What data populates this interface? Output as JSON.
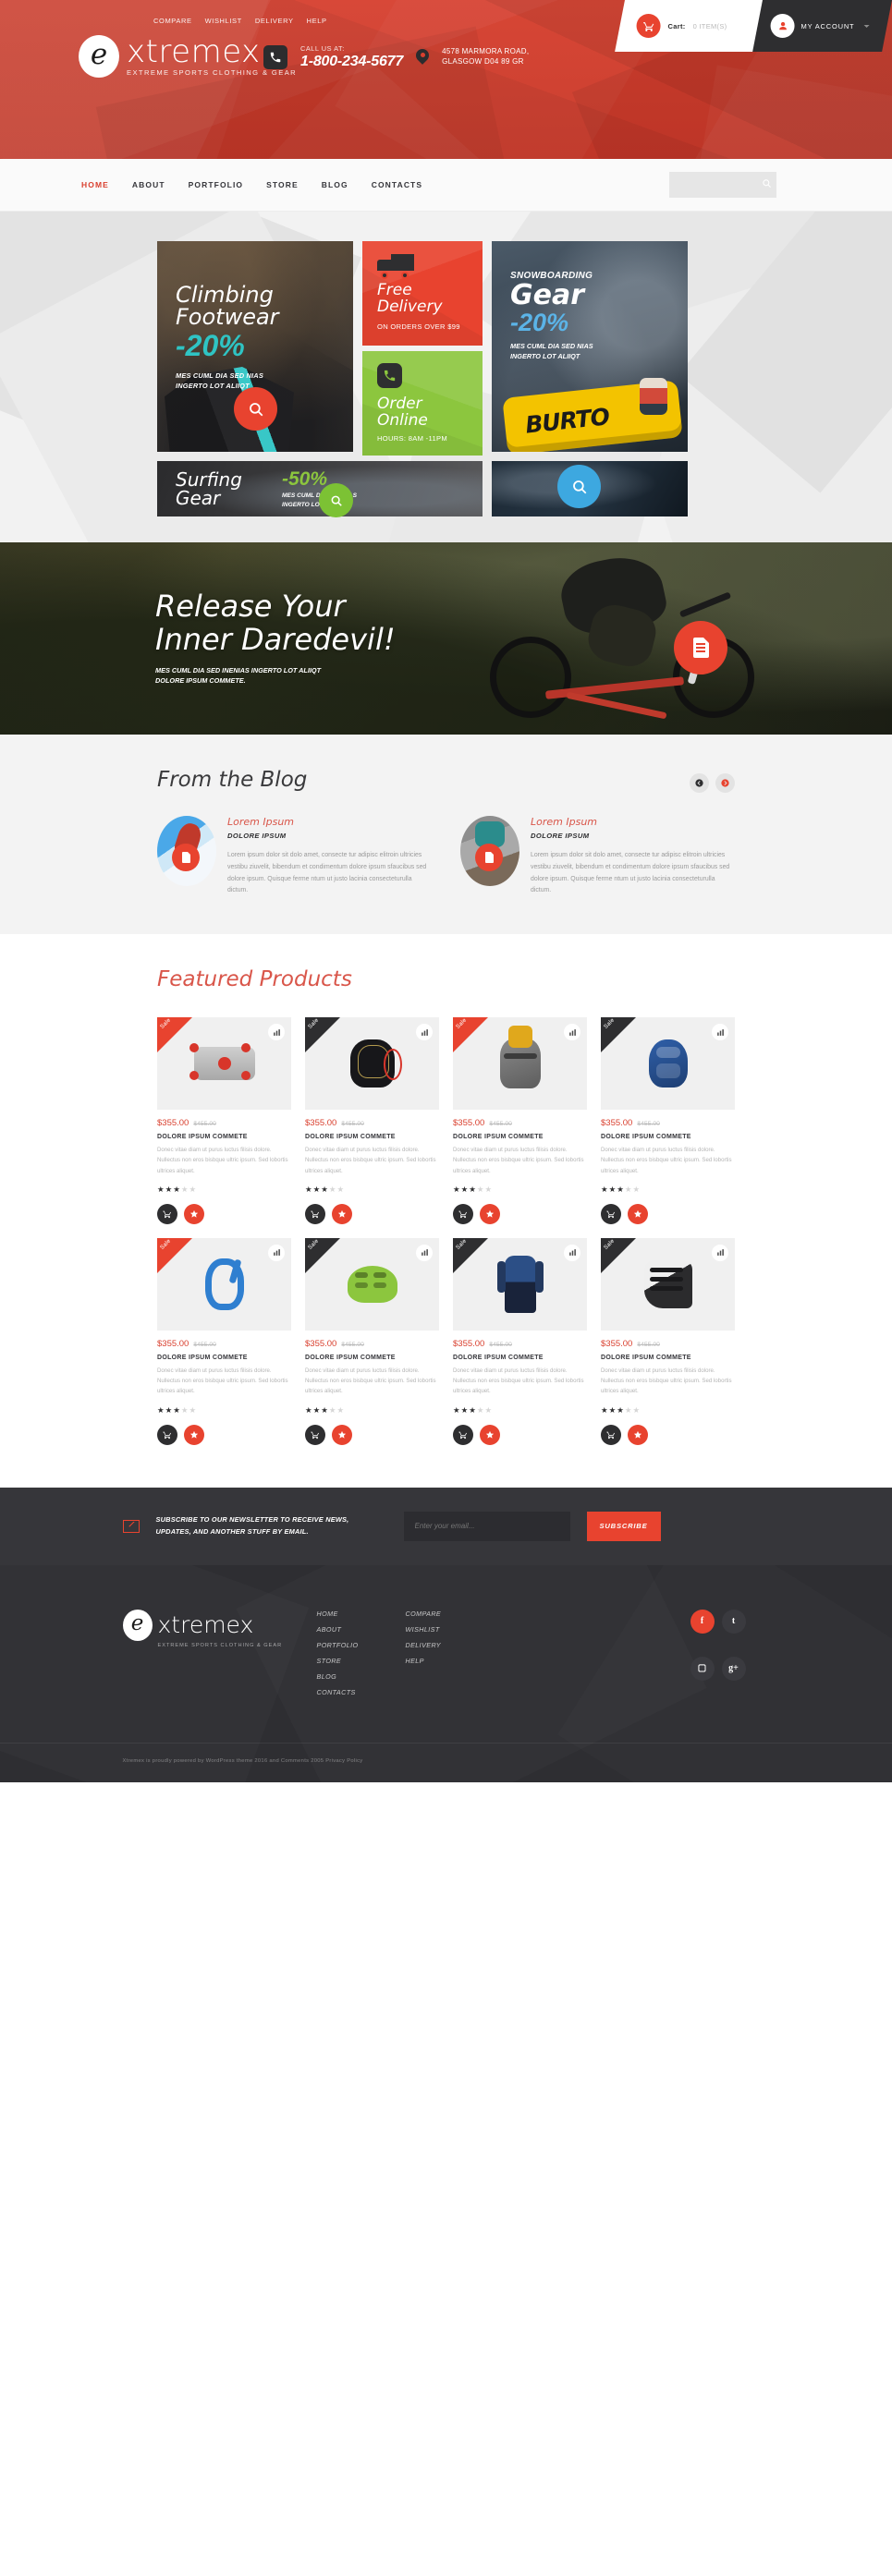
{
  "header": {
    "top_links": [
      {
        "label": "COMPARE"
      },
      {
        "label": "WISHLIST"
      },
      {
        "label": "DELIVERY"
      },
      {
        "label": "HELP"
      }
    ],
    "cart": {
      "label": "Cart:",
      "count": "0 ITEM(S)",
      "icon": "shopping-cart-icon"
    },
    "account": {
      "label": "MY ACCOUNT",
      "icon": "user-icon"
    },
    "logo": {
      "mark": "e",
      "name": "xtremex",
      "tagline": "EXTREME SPORTS CLOTHING & GEAR"
    },
    "contact": {
      "call_label": "CALL US AT:",
      "phone": "1-800-234-5677",
      "address_line1": "4578 MARMORA ROAD,",
      "address_line2": "GLASGOW D04 89 GR"
    }
  },
  "nav": {
    "items": [
      {
        "label": "HOME",
        "active": true
      },
      {
        "label": "ABOUT",
        "active": false
      },
      {
        "label": "PORTFOLIO",
        "active": false
      },
      {
        "label": "STORE",
        "active": false
      },
      {
        "label": "BLOG",
        "active": false
      },
      {
        "label": "CONTACTS",
        "active": false
      }
    ],
    "search": {
      "placeholder": "",
      "value": "",
      "icon": "search-icon"
    }
  },
  "banners": {
    "climbing": {
      "title_line1": "Climbing",
      "title_line2": "Footwear",
      "discount": "-20%",
      "sub_line1": "MES CUML DIA SED NIAS",
      "sub_line2": "INGERTO LOT ALIIQT"
    },
    "free_delivery": {
      "title_line1": "Free",
      "title_line2": "Delivery",
      "subtitle": "ON ORDERS OVER $99",
      "icon": "truck-icon"
    },
    "order_online": {
      "title_line1": "Order",
      "title_line2": "Online",
      "subtitle": "HOURS: 8AM -11PM",
      "icon": "phone-icon"
    },
    "snowboarding": {
      "kicker": "SNOWBOARDING",
      "title": "Gear",
      "discount": "-20%",
      "sub_line1": "MES CUML DIA SED NIAS",
      "sub_line2": "INGERTO LOT ALIIQT",
      "board_brand": "BURTO"
    },
    "surfing": {
      "title_line1": "Surfing",
      "title_line2": "Gear",
      "discount": "-50%",
      "sub_line1": "MES CUML DIA SED NIAS",
      "sub_line2": "INGERTO LOT ALIIQT"
    }
  },
  "hero": {
    "title_line1": "Release Your",
    "title_line2": "Inner Daredevil!",
    "sub_line1": "MES CUML DIA SED INENIAS INGERTO LOT ALIIQT",
    "sub_line2": "DOLORE IPSUM COMMETE.",
    "button_icon": "document-icon"
  },
  "blog": {
    "title": "From the Blog",
    "prev_icon": "chevron-left-icon",
    "next_icon": "chevron-right-icon",
    "posts": [
      {
        "title": "Lorem Ipsum",
        "subtitle": "DOLORE IPSUM",
        "text": "Lorem ipsum dolor sit dolo amet, consecte tur adipisc elitroin ultricies vestibu ziuvelit, bibendum et condimentum dolore ipsum sfaucibus sed dolore ipsum. Quisque ferme ntum ut justo lacinia consecteturulla dictum."
      },
      {
        "title": "Lorem Ipsum",
        "subtitle": "DOLORE IPSUM",
        "text": "Lorem ipsum dolor sit dolo amet, consecte tur adipisc elitroin ultricies vestibu ziuvelit, bibendum et condimentum dolore ipsum sfaucibus sed dolore ipsum. Quisque ferme ntum ut justo lacinia consecteturulla dictum."
      }
    ]
  },
  "featured": {
    "title": "Featured Products",
    "sale_label": "Sale",
    "products": [
      {
        "price": "$355.00",
        "old_price": "$455.00",
        "name": "DOLORE IPSUM COMMETE",
        "desc": "Donec vitae diam ut purus luctus filisis dolore. Nullectus non eros bisbque ultric ipsum. Sed lobortis ultrices aliquet.",
        "rating": 3,
        "ribbon": "red",
        "shape": "sh-binding"
      },
      {
        "price": "$355.00",
        "old_price": "$455.00",
        "name": "DOLORE IPSUM COMMETE",
        "desc": "Donec vitae diam ut purus luctus filisis dolore. Nullectus non eros bisbque ultric ipsum. Sed lobortis ultrices aliquet.",
        "rating": 3,
        "ribbon": "dark",
        "shape": "sh-pack"
      },
      {
        "price": "$355.00",
        "old_price": "$455.00",
        "name": "DOLORE IPSUM COMMETE",
        "desc": "Donec vitae diam ut purus luctus filisis dolore. Nullectus non eros bisbque ultric ipsum. Sed lobortis ultrices aliquet.",
        "rating": 3,
        "ribbon": "red",
        "shape": "sh-bag"
      },
      {
        "price": "$355.00",
        "old_price": "$455.00",
        "name": "DOLORE IPSUM COMMETE",
        "desc": "Donec vitae diam ut purus luctus filisis dolore. Nullectus non eros bisbque ultric ipsum. Sed lobortis ultrices aliquet.",
        "rating": 3,
        "ribbon": "dark",
        "shape": "sh-guard"
      },
      {
        "price": "$355.00",
        "old_price": "$455.00",
        "name": "DOLORE IPSUM COMMETE",
        "desc": "Donec vitae diam ut purus luctus filisis dolore. Nullectus non eros bisbque ultric ipsum. Sed lobortis ultrices aliquet.",
        "rating": 3,
        "ribbon": "red",
        "shape": "sh-carab"
      },
      {
        "price": "$355.00",
        "old_price": "$455.00",
        "name": "DOLORE IPSUM COMMETE",
        "desc": "Donec vitae diam ut purus luctus filisis dolore. Nullectus non eros bisbque ultric ipsum. Sed lobortis ultrices aliquet.",
        "rating": 3,
        "ribbon": "dark",
        "shape": "sh-helm"
      },
      {
        "price": "$355.00",
        "old_price": "$455.00",
        "name": "DOLORE IPSUM COMMETE",
        "desc": "Donec vitae diam ut purus luctus filisis dolore. Nullectus non eros bisbque ultric ipsum. Sed lobortis ultrices aliquet.",
        "rating": 3,
        "ribbon": "dark",
        "shape": "sh-suit"
      },
      {
        "price": "$355.00",
        "old_price": "$455.00",
        "name": "DOLORE IPSUM COMMETE",
        "desc": "Donec vitae diam ut purus luctus filisis dolore. Nullectus non eros bisbque ultric ipsum. Sed lobortis ultrices aliquet.",
        "rating": 3,
        "ribbon": "dark",
        "shape": "sh-boot"
      }
    ]
  },
  "newsletter": {
    "text_line1": "SUBSCRIBE TO OUR NEWSLETTER TO RECEIVE NEWS,",
    "text_line2": "UPDATES, AND ANOTHER STUFF BY EMAIL.",
    "placeholder": "Enter your email...",
    "value": "",
    "button": "SUBSCRIBE",
    "icon": "envelope-icon"
  },
  "footer": {
    "logo": {
      "mark": "e",
      "name": "xtremex",
      "tagline": "EXTREME SPORTS CLOTHING & GEAR"
    },
    "col1": [
      {
        "label": "HOME"
      },
      {
        "label": "ABOUT"
      },
      {
        "label": "PORTFOLIO"
      },
      {
        "label": "STORE"
      },
      {
        "label": "BLOG"
      },
      {
        "label": "CONTACTS"
      }
    ],
    "col2": [
      {
        "label": "COMPARE"
      },
      {
        "label": "WISHLIST"
      },
      {
        "label": "DELIVERY"
      },
      {
        "label": "HELP"
      }
    ],
    "social": [
      {
        "name": "facebook-icon",
        "glyph": "f",
        "cls": "soc-fb"
      },
      {
        "name": "twitter-icon",
        "glyph": "t",
        "cls": "soc-tw"
      },
      {
        "name": "instagram-icon",
        "glyph": "▢",
        "cls": "soc-in"
      },
      {
        "name": "google-plus-icon",
        "glyph": "g+",
        "cls": "soc-gp"
      }
    ],
    "copyright": "Xtremex is proudly powered by WordPress theme 2016 and Comments 2005 Privacy Policy"
  },
  "colors": {
    "brand_red": "#e8432f",
    "header_red": "#d9402f",
    "green": "#8cc63e",
    "teal": "#2fc4c4",
    "blue": "#5bb4e8",
    "dark": "#2e2e32"
  }
}
